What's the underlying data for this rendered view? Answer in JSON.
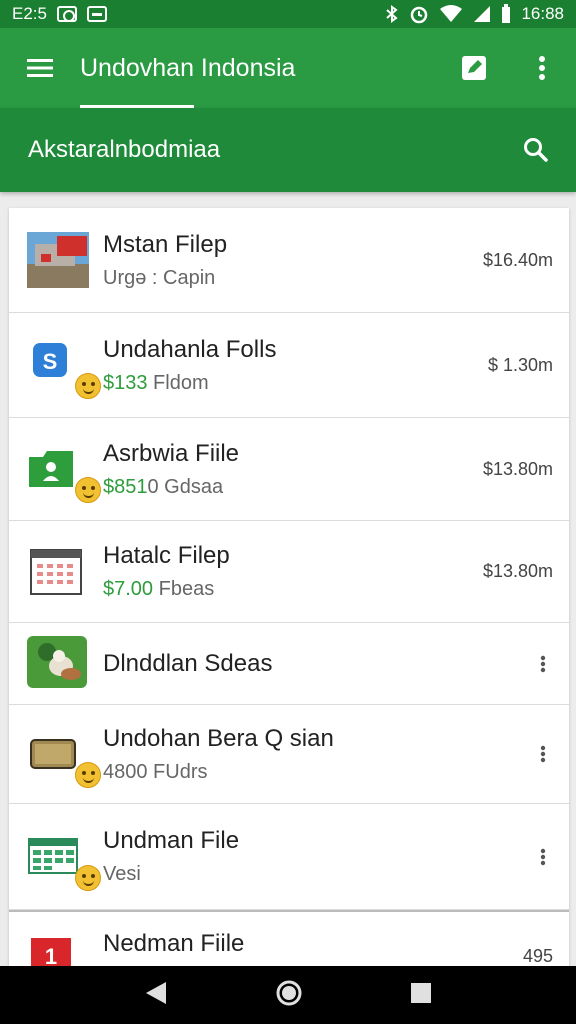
{
  "status_bar": {
    "left_time": "E2:5",
    "right_time": "16:88"
  },
  "app_bar": {
    "title": "Undovhan Indonsia"
  },
  "sub_bar": {
    "title": "Akstaralnbodmiaa"
  },
  "items": [
    {
      "title": "Mstan Filep",
      "sub_amount": "",
      "sub_label": "Urgə : Capin",
      "meta": "$16.40m",
      "icon": "photo-thumbnail-icon",
      "has_menu": false
    },
    {
      "title": "Undahanla Folls",
      "sub_amount": "$133",
      "sub_label": " Fldom",
      "meta": "$ 1.30m",
      "icon": "blue-s-app-icon",
      "has_menu": false
    },
    {
      "title": "Asrbwia Fiile",
      "sub_amount": "$851",
      "sub_label": "0 Gdsaa",
      "meta": "$13.80m",
      "icon": "green-folder-icon",
      "has_menu": false
    },
    {
      "title": "Hatalc Filep",
      "sub_amount": "$7.00",
      "sub_label": " Fbeas",
      "meta": "$13.80m",
      "icon": "calendar-grid-icon",
      "has_menu": false
    },
    {
      "title": "Dlnddlan Sdeas",
      "sub_amount": "",
      "sub_label": "",
      "meta": "",
      "icon": "animal-photo-icon",
      "has_menu": true
    },
    {
      "title": "Undohan Bera Q sian",
      "sub_amount": "",
      "sub_label": "4800 FUdrs",
      "meta": "",
      "icon": "card-icon",
      "has_menu": true
    },
    {
      "title": "Undman File",
      "sub_amount": "",
      "sub_label": "Vesi",
      "meta": "",
      "icon": "spreadsheet-icon",
      "has_menu": true
    },
    {
      "title": "Nedman Fiile",
      "sub_amount": "",
      "sub_label": "",
      "meta": "495",
      "icon": "red-number-icon",
      "has_menu": false
    }
  ],
  "colors": {
    "primary": "#2a9a43",
    "primary_dark": "#1b7f32",
    "accent_green": "#2e9d3c"
  }
}
